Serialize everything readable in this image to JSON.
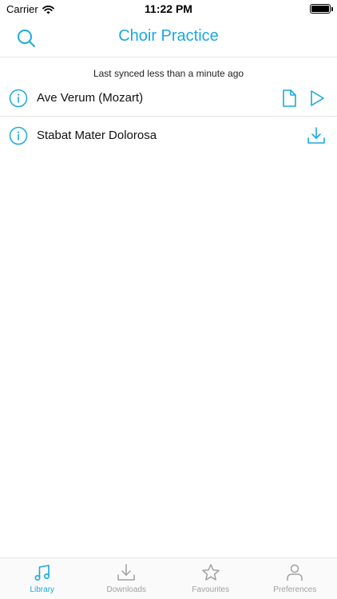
{
  "status_bar": {
    "carrier": "Carrier",
    "time": "11:22 PM"
  },
  "nav": {
    "title": "Choir Practice",
    "search_icon": "search-icon"
  },
  "sync_status": "Last synced less than a minute ago",
  "songs": [
    {
      "title": "Ave Verum (Mozart)",
      "actions": [
        "document-icon",
        "play-icon"
      ]
    },
    {
      "title": "Stabat Mater Dolorosa",
      "actions": [
        "download-icon"
      ]
    }
  ],
  "tabs": [
    {
      "label": "Library",
      "icon": "music-note-icon",
      "active": true
    },
    {
      "label": "Downloads",
      "icon": "download-icon",
      "active": false
    },
    {
      "label": "Favourites",
      "icon": "star-icon",
      "active": false
    },
    {
      "label": "Preferences",
      "icon": "person-icon",
      "active": false
    }
  ],
  "colors": {
    "accent": "#1ba9e0",
    "inactive": "#a0a0a0",
    "divider": "#e6e6e6"
  }
}
